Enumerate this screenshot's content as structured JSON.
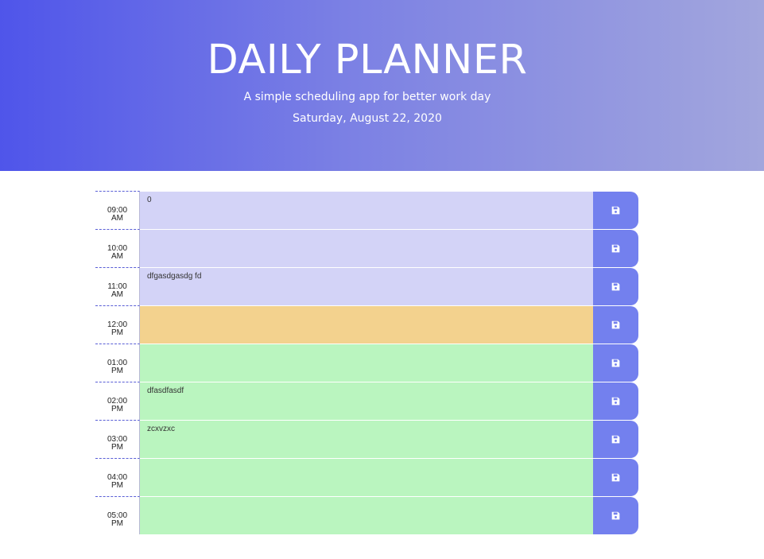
{
  "header": {
    "title": "DAILY PLANNER",
    "subtitle": "A simple scheduling app for better work day",
    "current_day": "Saturday, August 22, 2020"
  },
  "colors": {
    "past": "#d3d3f7",
    "present": "#f3d28e",
    "future": "#baf5bf",
    "save_button": "#7380ee"
  },
  "save_icon": "floppy-disk-icon",
  "time_blocks": [
    {
      "hour": "09:00",
      "period": "AM",
      "text": "0",
      "state": "past"
    },
    {
      "hour": "10:00",
      "period": "AM",
      "text": "",
      "state": "past"
    },
    {
      "hour": "11:00",
      "period": "AM",
      "text": "dfgasdgasdg fd",
      "state": "past"
    },
    {
      "hour": "12:00",
      "period": "PM",
      "text": "",
      "state": "present"
    },
    {
      "hour": "01:00",
      "period": "PM",
      "text": "",
      "state": "future"
    },
    {
      "hour": "02:00",
      "period": "PM",
      "text": "dfasdfasdf",
      "state": "future"
    },
    {
      "hour": "03:00",
      "period": "PM",
      "text": "zcxvzxc",
      "state": "future"
    },
    {
      "hour": "04:00",
      "period": "PM",
      "text": "",
      "state": "future"
    },
    {
      "hour": "05:00",
      "period": "PM",
      "text": "",
      "state": "future"
    }
  ]
}
